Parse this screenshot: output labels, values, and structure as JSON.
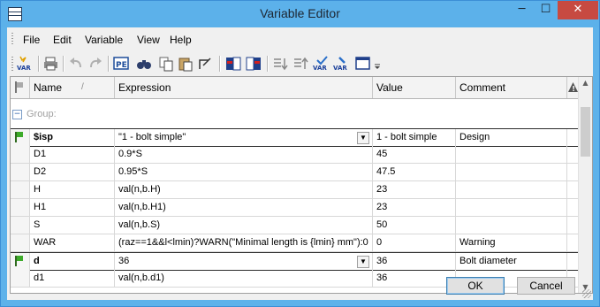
{
  "window": {
    "title": "Variable Editor",
    "min": "─",
    "max": "☐",
    "close": "✕"
  },
  "menu": [
    "File",
    "Edit",
    "Variable",
    "View",
    "Help"
  ],
  "toolbar": {
    "var_label": "VAR",
    "items": [
      "new-variable",
      "print",
      "undo",
      "redo",
      "properties",
      "find",
      "copy",
      "paste",
      "format",
      "insert-before",
      "insert-after",
      "move-down",
      "move-up",
      "var-check",
      "var-edit",
      "window",
      "more"
    ]
  },
  "grid": {
    "columns": {
      "name": "Name",
      "sort": "/",
      "expression": "Expression",
      "value": "Value",
      "comment": "Comment",
      "warn": "!"
    },
    "group_label": "Group:",
    "group_toggle": "−",
    "rows": [
      {
        "name": "$isp",
        "expression": "\"1 - bolt simple\"",
        "value": "1 - bolt simple",
        "comment": "Design",
        "flag": true,
        "bold": true,
        "dropdown": true
      },
      {
        "name": "D1",
        "expression": "0.9*S",
        "value": "45",
        "comment": ""
      },
      {
        "name": "D2",
        "expression": "0.95*S",
        "value": "47.5",
        "comment": ""
      },
      {
        "name": "H",
        "expression": "val(n,b.H)",
        "value": "23",
        "comment": ""
      },
      {
        "name": "H1",
        "expression": "val(n,b.H1)",
        "value": "23",
        "comment": ""
      },
      {
        "name": "S",
        "expression": "val(n,b.S)",
        "value": "50",
        "comment": ""
      },
      {
        "name": "WAR",
        "expression": "(raz==1&&l<lmin)?WARN(\"Minimal length is {lmin} mm\"):0",
        "value": "0",
        "comment": "Warning"
      },
      {
        "name": "d",
        "expression": "36",
        "value": "36",
        "comment": "Bolt diameter",
        "flag": true,
        "bold": true,
        "dropdown": true
      },
      {
        "name": "d1",
        "expression": "val(n,b.d1)",
        "value": "36",
        "comment": ""
      }
    ]
  },
  "buttons": {
    "ok": "OK",
    "cancel": "Cancel"
  },
  "colors": {
    "titlebar": "#5cb1ea",
    "close": "#c74a41",
    "flag": "#3dab2a"
  }
}
